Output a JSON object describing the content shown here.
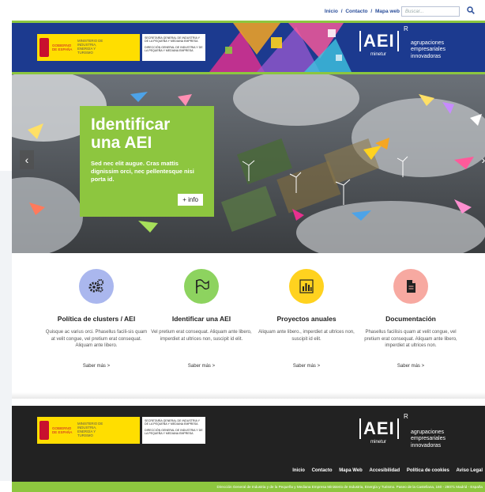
{
  "topbar": {
    "links": [
      "Inicio",
      "Contacto",
      "Mapa web"
    ],
    "separator": "/",
    "search_placeholder": "Buscar..."
  },
  "header": {
    "gov_label": "GOBIERNO DE ESPAÑA",
    "ministry_label": "MINISTERIO DE INDUSTRIA, ENERGÍA Y TURISMO",
    "secretariat_text": "SECRETARÍA GENERAL DE INDUSTRIA Y DE LA PEQUEÑA Y MEDIANA EMPRESA",
    "direction_text": "DIRECCIÓN GENERAL DE INDUSTRIA Y DE LA PEQUEÑA Y MEDIANA EMPRESA",
    "logo_text": "AEI",
    "logo_sup": "R",
    "logo_sub": "minetur",
    "tagline": [
      "agrupaciones",
      "empresariales",
      "innovadoras"
    ]
  },
  "hero": {
    "title": "Identificar una AEI",
    "text": "Sed nec elit augue. Cras mattis dignissim orci, nec pellentesque nisi porta id.",
    "button": "+ info",
    "prev_arrow": "‹",
    "next_arrow": "›"
  },
  "features": [
    {
      "title": "Política de clusters / AEI",
      "text": "Quisque ac varius orci. Phasellus facili-sis quam at velit congue, vel pretium erat consequat. Aliquam ante libero.",
      "more": "Saber más >",
      "color": "#aab7ee",
      "icon": "gears-icon"
    },
    {
      "title": "Identificar una AEI",
      "text": "Vel pretium erat consequat. Aliquam ante libero, imperdiet at ultrices non, suscipit id elit.",
      "more": "Saber más >",
      "color": "#8dd35f",
      "icon": "flag-icon"
    },
    {
      "title": "Proyectos anuales",
      "text": "Aliquam ante libero., imperdiet at ultrices non, suscipit id elit.",
      "more": "Saber más >",
      "color": "#ffd21f",
      "icon": "bar-chart-icon"
    },
    {
      "title": "Documentación",
      "text": "Phasellus facilisis quam at velit congue, vel pretium erat consequat. Aliquam ante libero, imperdiet at ultrices non.",
      "more": "Saber más >",
      "color": "#f7a9a1",
      "icon": "document-icon"
    }
  ],
  "footer": {
    "nav": [
      "Inicio",
      "Contacto",
      "Mapa Web",
      "Accesibilidad",
      "Política de cookies",
      "Aviso Legal"
    ],
    "address": "Dirección General de Industria y de la Pequeña y Mediana Empresa Ministerio de Industria, Energía y Turismo. Paseo de la Castellana, 160 - 28071 Madrid - España"
  },
  "colors": {
    "brand_blue": "#1c3a8f",
    "accent_green": "#8dc63f",
    "footer_bg": "#222222",
    "link_blue": "#2b4e9a"
  }
}
